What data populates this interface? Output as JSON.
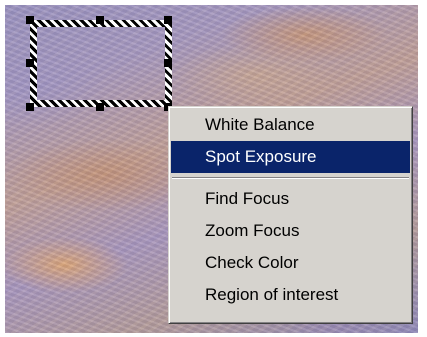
{
  "context_menu": {
    "items_group1": [
      {
        "label": "White Balance",
        "selected": false
      },
      {
        "label": "Spot Exposure",
        "selected": true
      }
    ],
    "items_group2": [
      {
        "label": "Find Focus",
        "selected": false
      },
      {
        "label": "Zoom Focus",
        "selected": false
      },
      {
        "label": "Check Color",
        "selected": false
      },
      {
        "label": "Region of interest",
        "selected": false
      }
    ]
  },
  "colors": {
    "menu_background": "#d6d3ce",
    "menu_highlight": "#0a246a",
    "menu_highlight_text": "#ffffff"
  }
}
